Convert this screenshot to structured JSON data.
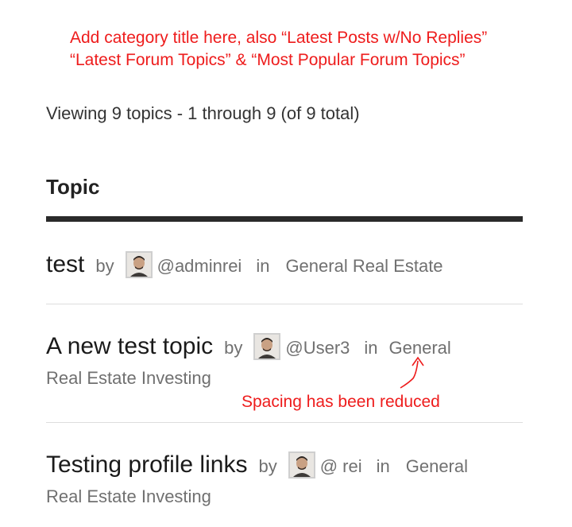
{
  "annotation_top": {
    "line1": "Add category title here, also “Latest Posts w/No Replies”",
    "line2": "“Latest Forum Topics” & “Most Popular Forum Topics”"
  },
  "viewing_text": "Viewing 9 topics - 1 through 9 (of 9 total)",
  "column_header": "Topic",
  "topics": [
    {
      "title": "test",
      "by": "by",
      "user": "@adminrei",
      "in": "in",
      "forum_line1": "General Real Estate",
      "forum_line2": ""
    },
    {
      "title": "A new test topic",
      "by": "by",
      "user": "@User3",
      "in": "in",
      "forum_line1": "General",
      "forum_line2": "Real Estate Investing"
    },
    {
      "title": "Testing profile links",
      "by": "by",
      "user": "@ rei",
      "in": "in",
      "forum_line1": "General",
      "forum_line2": "Real Estate Investing"
    }
  ],
  "annotation_spacing": "Spacing has been reduced",
  "colors": {
    "annotation": "#ee1c1c",
    "header_rule": "#2a2a2a",
    "meta_text": "#707070"
  }
}
